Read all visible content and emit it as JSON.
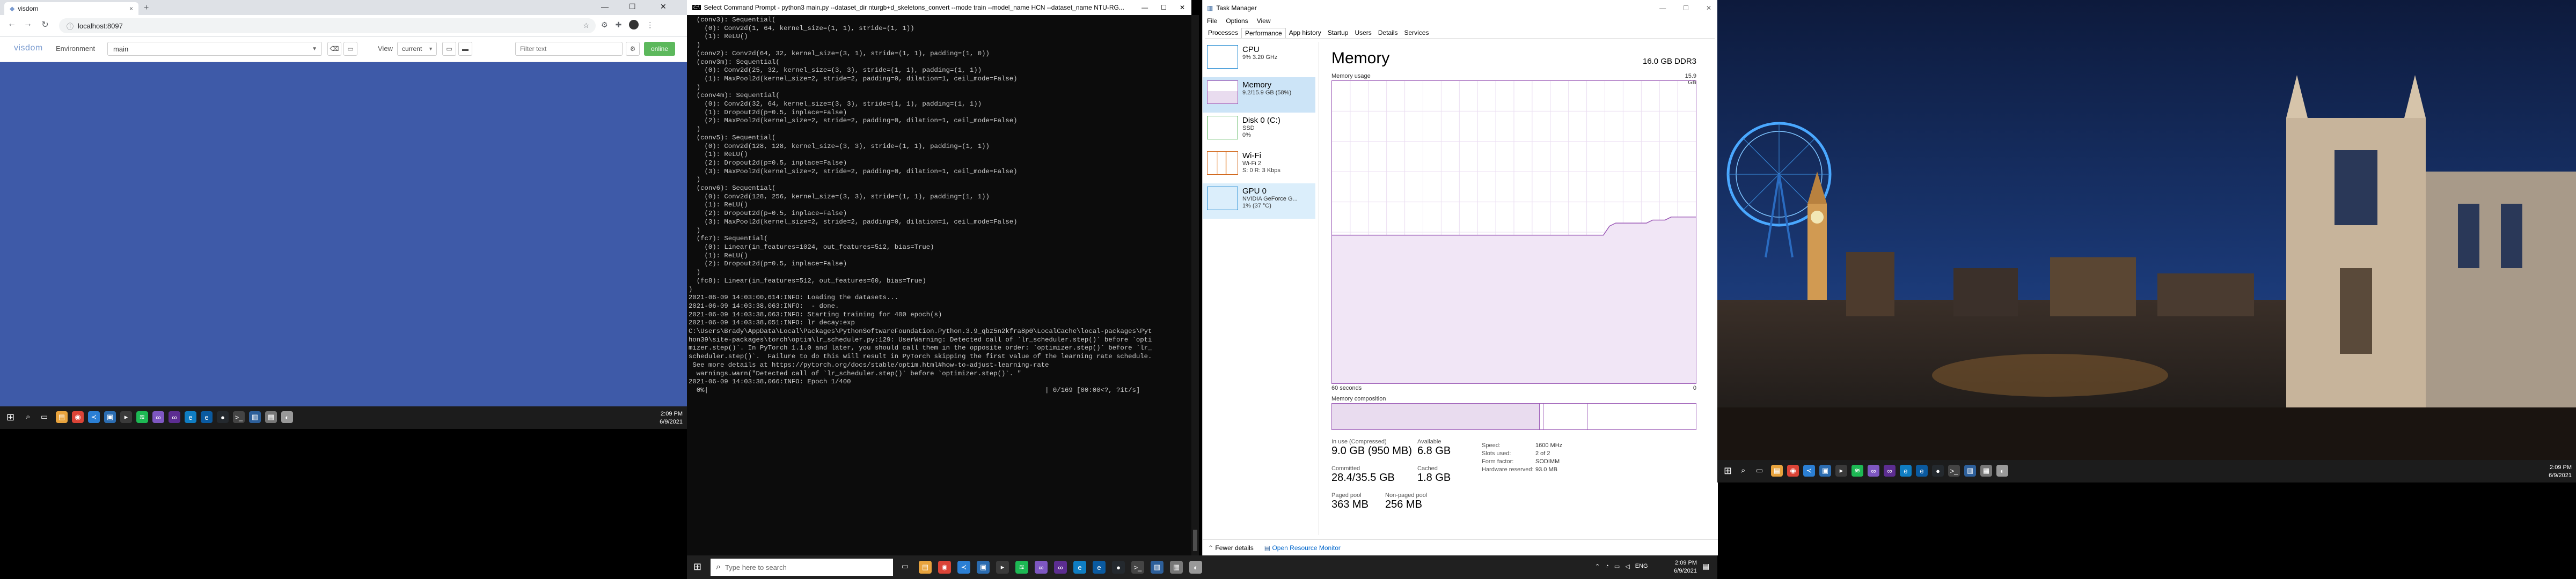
{
  "chrome": {
    "tab_title": "visdom",
    "tab_close": "×",
    "new_tab": "+",
    "address": "localhost:8097",
    "window_controls": [
      "—",
      "☐",
      "✕"
    ]
  },
  "visdom": {
    "logo": "visdom",
    "environment_label": "Environment",
    "environment_value": "main",
    "view_label": "View",
    "view_value": "current",
    "filter_placeholder": "Filter text",
    "online_label": "online"
  },
  "taskbar1": {
    "time": "2:09 PM",
    "date": "6/9/2021",
    "apps": [
      {
        "icon": "folder-icon",
        "color": "#e8a33d",
        "glyph": "▤"
      },
      {
        "icon": "chrome-icon",
        "color": "#db4437",
        "glyph": "◉"
      },
      {
        "icon": "vs-code-icon",
        "color": "#2b7fd4",
        "glyph": "≺"
      },
      {
        "icon": "store-icon",
        "color": "#2b6cb0",
        "glyph": "▣"
      },
      {
        "icon": "terminal-icon",
        "color": "#3a3a3a",
        "glyph": "▸"
      },
      {
        "icon": "spotify-icon",
        "color": "#1db954",
        "glyph": "≋"
      },
      {
        "icon": "visual-studio-icon",
        "color": "#7e57c2",
        "glyph": "∞"
      },
      {
        "icon": "visual-studio-icon",
        "color": "#5c2d91",
        "glyph": "∞"
      },
      {
        "icon": "edge-icon",
        "color": "#0f7dc2",
        "glyph": "e"
      },
      {
        "icon": "edge-icon",
        "color": "#0a5aa0",
        "glyph": "e"
      },
      {
        "icon": "github-icon",
        "color": "#24292e",
        "glyph": "●"
      },
      {
        "icon": "cmd-icon",
        "color": "#444",
        "glyph": ">_"
      },
      {
        "icon": "taskmgr-icon",
        "color": "#2d5f9a",
        "glyph": "▥"
      },
      {
        "icon": "files-icon",
        "color": "#777",
        "glyph": "▦"
      },
      {
        "icon": "photos-icon",
        "color": "#999",
        "glyph": "◐"
      }
    ]
  },
  "cmd": {
    "title": "Select Command Prompt - python3 main.py --dataset_dir nturgb+d_skeletons_convert --mode train --model_name HCN --dataset_name NTU-RG...",
    "lines": [
      "  (conv3): Sequential(",
      "    (0): Conv2d(1, 64, kernel_size=(1, 1), stride=(1, 1))",
      "    (1): ReLU()",
      "  )",
      "  (conv2): Conv2d(64, 32, kernel_size=(3, 1), stride=(1, 1), padding=(1, 0))",
      "  (conv3m): Sequential(",
      "    (0): Conv2d(25, 32, kernel_size=(3, 3), stride=(1, 1), padding=(1, 1))",
      "    (1): MaxPool2d(kernel_size=2, stride=2, padding=0, dilation=1, ceil_mode=False)",
      "  )",
      "  (conv4m): Sequential(",
      "    (0): Conv2d(32, 64, kernel_size=(3, 3), stride=(1, 1), padding=(1, 1))",
      "    (1): Dropout2d(p=0.5, inplace=False)",
      "    (2): MaxPool2d(kernel_size=2, stride=2, padding=0, dilation=1, ceil_mode=False)",
      "  )",
      "  (conv5): Sequential(",
      "    (0): Conv2d(128, 128, kernel_size=(3, 3), stride=(1, 1), padding=(1, 1))",
      "    (1): ReLU()",
      "    (2): Dropout2d(p=0.5, inplace=False)",
      "    (3): MaxPool2d(kernel_size=2, stride=2, padding=0, dilation=1, ceil_mode=False)",
      "  )",
      "  (conv6): Sequential(",
      "    (0): Conv2d(128, 256, kernel_size=(3, 3), stride=(1, 1), padding=(1, 1))",
      "    (1): ReLU()",
      "    (2): Dropout2d(p=0.5, inplace=False)",
      "    (3): MaxPool2d(kernel_size=2, stride=2, padding=0, dilation=1, ceil_mode=False)",
      "  )",
      "  (fc7): Sequential(",
      "    (0): Linear(in_features=1024, out_features=512, bias=True)",
      "    (1): ReLU()",
      "    (2): Dropout2d(p=0.5, inplace=False)",
      "  )",
      "  (fc8): Linear(in_features=512, out_features=60, bias=True)",
      ")",
      "2021-06-09 14:03:00,614:INFO: Loading the datasets...",
      "2021-06-09 14:03:38,063:INFO:  - done.",
      "2021-06-09 14:03:38,063:INFO: Starting training for 400 epoch(s)",
      "2021-06-09 14:03:38,051:INFO: lr decay:exp",
      "C:\\Users\\Brady\\AppData\\Local\\Packages\\PythonSoftwareFoundation.Python.3.9_qbz5n2kfra8p0\\LocalCache\\local-packages\\Pyt",
      "hon39\\site-packages\\torch\\optim\\lr_scheduler.py:129: UserWarning: Detected call of `lr_scheduler.step()` before `opti",
      "mizer.step()`. In PyTorch 1.1.0 and later, you should call them in the opposite order: `optimizer.step()` before `lr_",
      "scheduler.step()`.  Failure to do this will result in PyTorch skipping the first value of the learning rate schedule.",
      " See more details at https://pytorch.org/docs/stable/optim.html#how-to-adjust-learning-rate",
      "  warnings.warn(\"Detected call of `lr_scheduler.step()` before `optimizer.step()`. \"",
      "2021-06-09 14:03:38,066:INFO: Epoch 1/400",
      "  0%|                                                                                     | 0/169 [00:00<?, ?it/s]"
    ]
  },
  "taskmgr": {
    "title": "Task Manager",
    "menu": [
      "File",
      "Options",
      "View"
    ],
    "tabs": [
      "Processes",
      "Performance",
      "App history",
      "Startup",
      "Users",
      "Details",
      "Services"
    ],
    "active_tab": "Performance",
    "sidebar": [
      {
        "name": "CPU",
        "sub1": "9% 3.20 GHz",
        "sub2": "",
        "color": "#1784d0"
      },
      {
        "name": "Memory",
        "sub1": "9.2/15.9 GB (58%)",
        "sub2": "",
        "color": "#9b59b6"
      },
      {
        "name": "Disk 0 (C:)",
        "sub1": "SSD",
        "sub2": "0%",
        "color": "#4caf50"
      },
      {
        "name": "Wi-Fi",
        "sub1": "Wi-Fi 2",
        "sub2": "S: 0  R: 3 Kbps",
        "color": "#d2691e"
      },
      {
        "name": "GPU 0",
        "sub1": "NVIDIA GeForce G...",
        "sub2": "1% (37 °C)",
        "color": "#1784d0"
      }
    ],
    "heading": "Memory",
    "total": "16.0 GB DDR3",
    "usage_label": "Memory usage",
    "usage_max": "15.9 GB",
    "graph_left": "60 seconds",
    "graph_right": "0",
    "composition_label": "Memory composition",
    "in_use_label": "In use (Compressed)",
    "in_use_value": "9.0 GB (950 MB)",
    "available_label": "Available",
    "available_value": "6.8 GB",
    "committed_label": "Committed",
    "committed_value": "28.4/35.5 GB",
    "cached_label": "Cached",
    "cached_value": "1.8 GB",
    "paged_label": "Paged pool",
    "paged_value": "363 MB",
    "nonpaged_label": "Non-paged pool",
    "nonpaged_value": "256 MB",
    "kv": [
      {
        "k": "Speed:",
        "v": "1600 MHz"
      },
      {
        "k": "Slots used:",
        "v": "2 of 2"
      },
      {
        "k": "Form factor:",
        "v": "SODIMM"
      },
      {
        "k": "Hardware reserved:",
        "v": "93.0 MB"
      }
    ],
    "fewer_details": "Fewer details",
    "open_resmon": "Open Resource Monitor",
    "mem_history_pct": [
      49,
      49,
      49,
      49,
      49,
      49,
      49,
      49,
      49,
      49,
      49,
      49,
      49,
      49,
      49,
      49,
      49,
      49,
      49,
      49,
      49,
      49,
      49,
      49,
      49,
      49,
      49,
      49,
      49,
      49,
      49,
      49,
      49,
      49,
      49,
      49,
      49,
      49,
      49,
      49,
      49,
      49,
      49,
      49,
      49,
      52,
      53,
      53,
      53,
      53,
      53,
      53,
      54,
      54,
      54,
      55,
      55,
      55,
      55,
      55
    ]
  },
  "taskbar2": {
    "search_placeholder": "Type here to search",
    "time": "2:09 PM",
    "date": "6/9/2021"
  },
  "taskbar3": {
    "time": "2:09 PM",
    "date": "6/9/2021"
  }
}
